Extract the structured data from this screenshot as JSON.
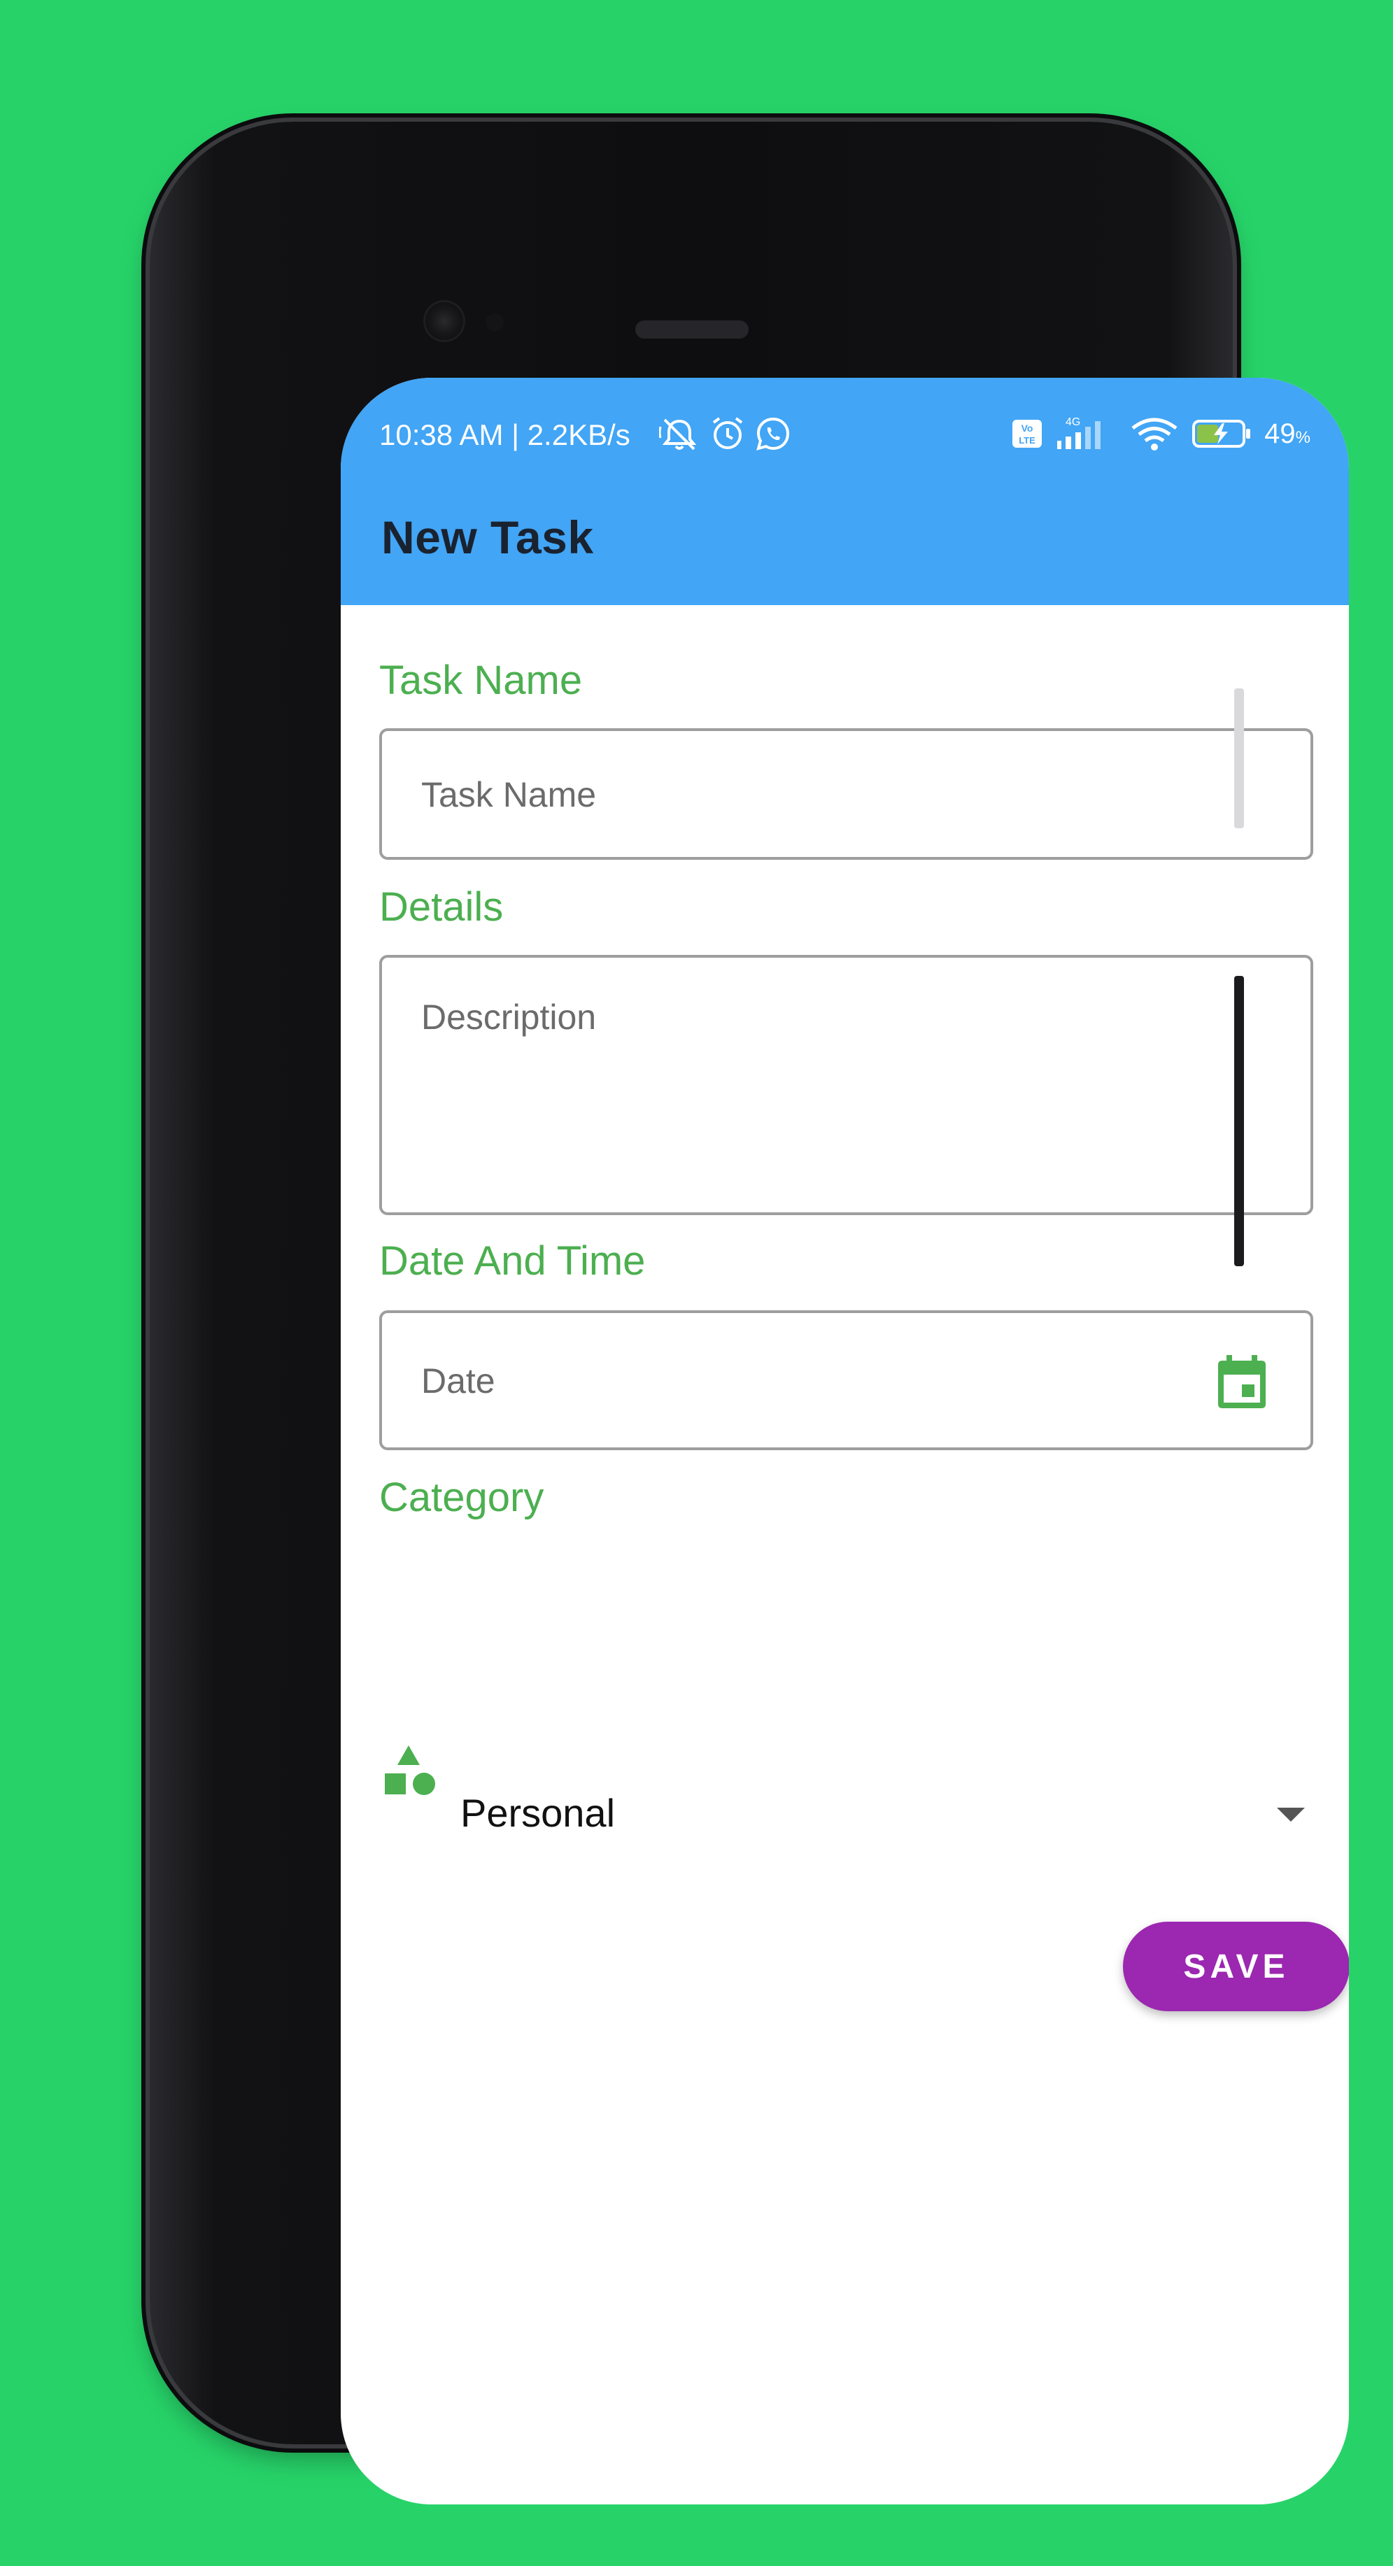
{
  "status_bar": {
    "time_speed": "10:38 AM | 2.2KB/s",
    "network_type": "4G",
    "volte_label": "Vo LTE",
    "battery": "49",
    "battery_unit": "%"
  },
  "app_bar": {
    "title": "New Task"
  },
  "form": {
    "task_name": {
      "label": "Task Name",
      "placeholder": "Task Name"
    },
    "details": {
      "label": "Details",
      "placeholder": "Description"
    },
    "date_time": {
      "label": "Date And Time",
      "placeholder": "Date"
    },
    "category": {
      "label": "Category",
      "selected": "Personal"
    },
    "save_label": "SAVE"
  },
  "colors": {
    "background": "#27d369",
    "app_bar": "#42a5f5",
    "label_green": "#4caf50",
    "save_button": "#9c27b0"
  },
  "icons": {
    "status_left": [
      "mute-notification-icon",
      "alarm-icon",
      "whatsapp-icon"
    ],
    "status_right": [
      "volte-icon",
      "signal-icon",
      "wifi-icon",
      "battery-charging-icon"
    ],
    "date_field": "calendar-icon",
    "category_field": "category-shapes-icon",
    "category_dropdown": "dropdown-arrow-icon"
  }
}
